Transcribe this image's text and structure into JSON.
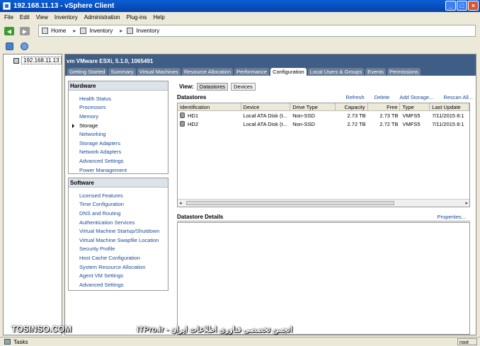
{
  "window": {
    "title": "192.168.11.13 - vSphere Client"
  },
  "menu": [
    "File",
    "Edit",
    "View",
    "Inventory",
    "Administration",
    "Plug-ins",
    "Help"
  ],
  "breadcrumb": [
    "Home",
    "Inventory",
    "Inventory"
  ],
  "tree": {
    "host": "192.168.11.13"
  },
  "host_header": "vm VMware ESXi, 5.1.0, 1065491",
  "tabs": [
    "Getting Started",
    "Summary",
    "Virtual Machines",
    "Resource Allocation",
    "Performance",
    "Configuration",
    "Local Users & Groups",
    "Events",
    "Permissions"
  ],
  "active_tab": "Configuration",
  "hardware": {
    "title": "Hardware",
    "items": [
      "Health Status",
      "Processors",
      "Memory",
      "Storage",
      "Networking",
      "Storage Adapters",
      "Network Adapters",
      "Advanced Settings",
      "Power Management"
    ],
    "selected": "Storage"
  },
  "software": {
    "title": "Software",
    "items": [
      "Licensed Features",
      "Time Configuration",
      "DNS and Routing",
      "Authentication Services",
      "Virtual Machine Startup/Shutdown",
      "Virtual Machine Swapfile Location",
      "Security Profile",
      "Host Cache Configuration",
      "System Resource Allocation",
      "Agent VM Settings",
      "Advanced Settings"
    ]
  },
  "view": {
    "label": "View:",
    "datastores": "Datastores",
    "devices": "Devices"
  },
  "datastores": {
    "title": "Datastores",
    "actions": [
      "Refresh",
      "Delete",
      "Add Storage...",
      "Rescan All..."
    ],
    "columns": [
      "Identification",
      "Device",
      "Drive Type",
      "Capacity",
      "Free",
      "Type",
      "Last Update"
    ],
    "rows": [
      [
        "HD1",
        "Local ATA Disk (t...",
        "Non-SSD",
        "2.73 TB",
        "2.73 TB",
        "VMFS5",
        "7/11/2015 8:1"
      ],
      [
        "HD2",
        "Local ATA Disk (t...",
        "Non-SSD",
        "2.72 TB",
        "2.72 TB",
        "VMFS5",
        "7/11/2015 8:1"
      ]
    ]
  },
  "details": {
    "title": "Datastore Details",
    "properties": "Properties..."
  },
  "watermark": {
    "left": "TOSINSO.COM",
    "right": "ITPro.ir - انجمن تخصصی فناوری اطلاعات ایران"
  },
  "status": {
    "tasks": "Tasks",
    "user": "root"
  }
}
